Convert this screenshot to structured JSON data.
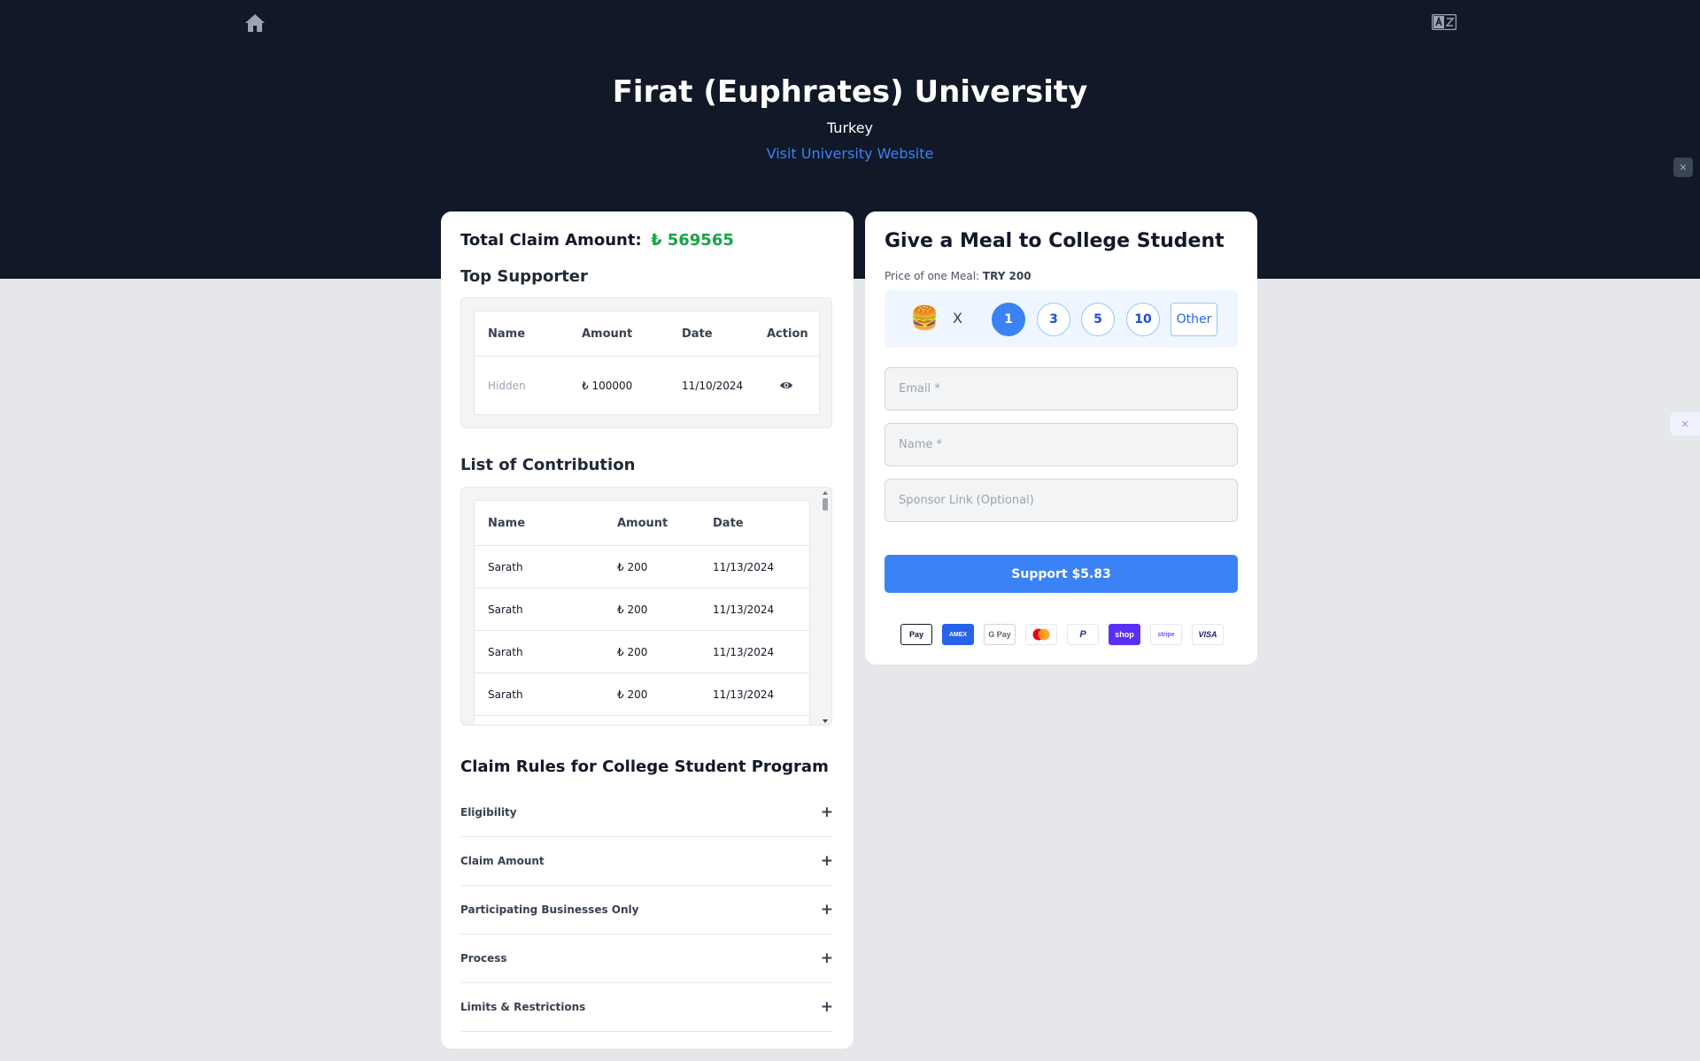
{
  "header": {
    "title": "Firat (Euphrates) University",
    "country": "Turkey",
    "website_link": "Visit University Website",
    "home_icon": "home-icon",
    "language_icon": "translate-icon"
  },
  "claim": {
    "total_label": "Total Claim Amount:",
    "total_value": "₺ 569565"
  },
  "top_supporter": {
    "heading": "Top Supporter",
    "columns": [
      "Name",
      "Amount",
      "Date",
      "Action"
    ],
    "rows": [
      {
        "name": "Hidden",
        "amount": "₺ 100000",
        "date": "11/10/2024",
        "action_icon": "eye-icon"
      }
    ]
  },
  "contributions": {
    "heading": "List of Contribution",
    "columns": [
      "Name",
      "Amount",
      "Date"
    ],
    "rows": [
      {
        "name": "Sarath",
        "amount": "₺ 200",
        "date": "11/13/2024"
      },
      {
        "name": "Sarath",
        "amount": "₺ 200",
        "date": "11/13/2024"
      },
      {
        "name": "Sarath",
        "amount": "₺ 200",
        "date": "11/13/2024"
      },
      {
        "name": "Sarath",
        "amount": "₺ 200",
        "date": "11/13/2024"
      }
    ]
  },
  "rules": {
    "heading": "Claim Rules for College Student Program",
    "items": [
      {
        "label": "Eligibility",
        "toggle": "+"
      },
      {
        "label": "Claim Amount",
        "toggle": "+"
      },
      {
        "label": "Participating Businesses Only",
        "toggle": "+"
      },
      {
        "label": "Process",
        "toggle": "+"
      },
      {
        "label": "Limits & Restrictions",
        "toggle": "+"
      }
    ]
  },
  "donate": {
    "title": "Give a Meal to College Student",
    "price_label": "Price of one Meal:",
    "price_value": "TRY 200",
    "meal_icon": "🍔",
    "times": "X",
    "quantities": [
      "1",
      "3",
      "5",
      "10"
    ],
    "selected_quantity": "1",
    "other_label": "Other",
    "email_placeholder": "Email *",
    "name_placeholder": "Name *",
    "sponsor_placeholder": "Sponsor Link (Optional)",
    "email_value": "",
    "name_value": "",
    "sponsor_value": "",
    "support_button": "Support $5.83",
    "payment_methods": [
      "Pay",
      "AMEX",
      "G Pay",
      "mastercard",
      "P",
      "shop",
      "stripe",
      "VISA"
    ]
  },
  "colors": {
    "header_bg": "#111827",
    "accent": "#3b82f6",
    "amount_green": "#16a34a",
    "page_bg": "#e5e7eb"
  }
}
